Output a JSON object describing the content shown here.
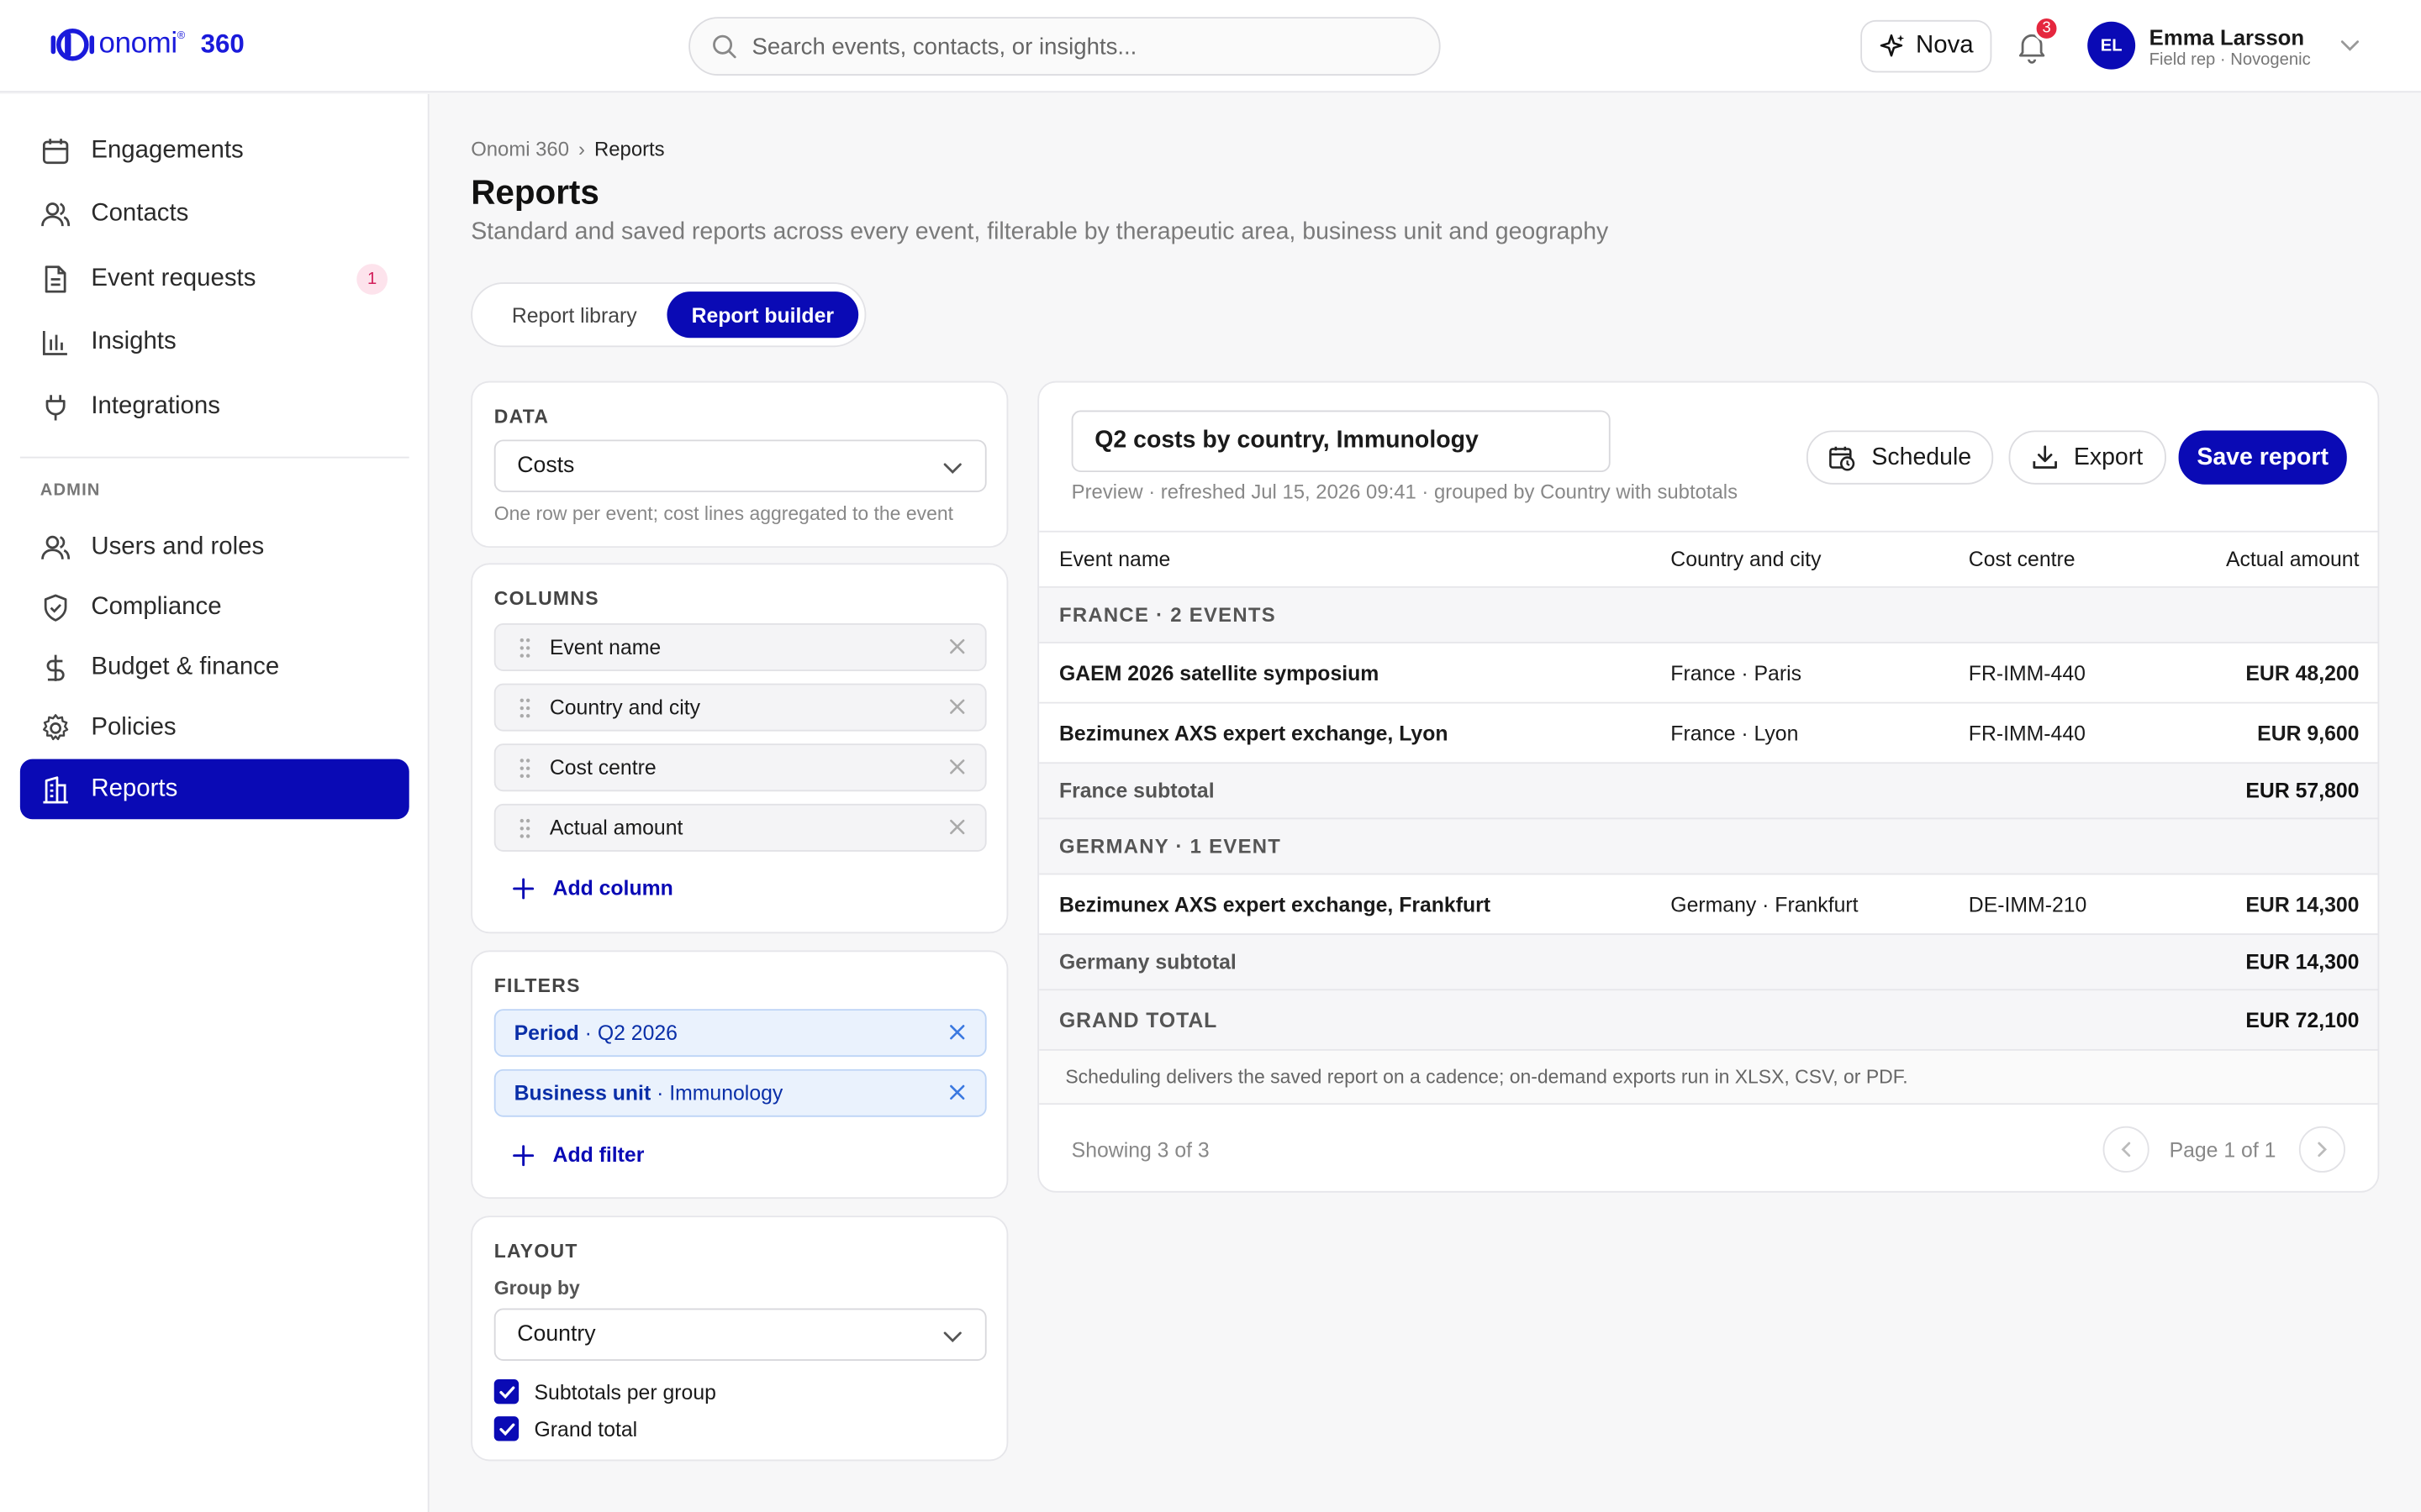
{
  "app": {
    "logo_text": "onomi",
    "logo_sup": "®",
    "logo_num": "360"
  },
  "header": {
    "search_placeholder": "Search events, contacts, or insights...",
    "nova_label": "Nova",
    "notifications_count": "3",
    "user_initials": "EL",
    "user_name": "Emma Larsson",
    "user_role": "Field rep · Novogenic"
  },
  "sidebar": {
    "items": [
      {
        "label": "Engagements",
        "icon": "calendar-icon"
      },
      {
        "label": "Contacts",
        "icon": "users-icon"
      },
      {
        "label": "Event requests",
        "icon": "document-icon",
        "badge": "1"
      },
      {
        "label": "Insights",
        "icon": "bar-chart-icon"
      },
      {
        "label": "Integrations",
        "icon": "plug-icon"
      }
    ],
    "admin_label": "ADMIN",
    "admin_items": [
      {
        "label": "Users and roles",
        "icon": "users-icon"
      },
      {
        "label": "Compliance",
        "icon": "shield-icon"
      },
      {
        "label": "Budget & finance",
        "icon": "dollar-icon"
      },
      {
        "label": "Policies",
        "icon": "gear-icon"
      },
      {
        "label": "Reports",
        "icon": "building-icon",
        "active": true
      }
    ]
  },
  "breadcrumb": {
    "root": "Onomi 360",
    "sep": "›",
    "current": "Reports"
  },
  "page": {
    "title": "Reports",
    "subtitle": "Standard and saved reports across every event, filterable by therapeutic area, business unit and geography"
  },
  "tabs": {
    "library": "Report library",
    "builder": "Report builder",
    "active": "builder"
  },
  "builder": {
    "data_label": "DATA",
    "data_value": "Costs",
    "data_hint": "One row per event; cost lines aggregated to the event",
    "columns_label": "COLUMNS",
    "columns": [
      "Event name",
      "Country and city",
      "Cost centre",
      "Actual amount"
    ],
    "add_column": "Add column",
    "filters_label": "FILTERS",
    "filters": [
      {
        "key": "Period",
        "value": "Q2 2026"
      },
      {
        "key": "Business unit",
        "value": "Immunology"
      }
    ],
    "add_filter": "Add filter",
    "layout_label": "LAYOUT",
    "group_by_label": "Group by",
    "group_by_value": "Country",
    "subtotals_label": "Subtotals per group",
    "grand_total_label": "Grand total"
  },
  "report": {
    "title": "Q2 costs by country, Immunology",
    "preview": "Preview · refreshed Jul 15, 2026 09:41 · grouped by Country with subtotals",
    "schedule": "Schedule",
    "export": "Export",
    "save": "Save report",
    "headers": [
      "Event name",
      "Country and city",
      "Cost centre",
      "Actual amount"
    ],
    "groups": [
      {
        "label": "FRANCE · 2 EVENTS",
        "rows": [
          [
            "GAEM 2026 satellite symposium",
            "France · Paris",
            "FR-IMM-440",
            "EUR 48,200"
          ],
          [
            "Bezimunex AXS expert exchange, Lyon",
            "France · Lyon",
            "FR-IMM-440",
            "EUR 9,600"
          ]
        ],
        "subtotal_label": "France subtotal",
        "subtotal": "EUR 57,800"
      },
      {
        "label": "GERMANY · 1 EVENT",
        "rows": [
          [
            "Bezimunex AXS expert exchange, Frankfurt",
            "Germany · Frankfurt",
            "DE-IMM-210",
            "EUR 14,300"
          ]
        ],
        "subtotal_label": "Germany subtotal",
        "subtotal": "EUR 14,300"
      }
    ],
    "grand_total_label": "GRAND TOTAL",
    "grand_total": "EUR 72,100",
    "note": "Scheduling delivers the saved report on a cadence; on-demand exports run in XLSX, CSV, or PDF.",
    "showing": "Showing 3 of 3",
    "page": "Page 1 of 1"
  },
  "colors": {
    "brand": "#0a0ab5",
    "badge_red": "#e5273e",
    "filter_bg": "#eaf2fd"
  }
}
